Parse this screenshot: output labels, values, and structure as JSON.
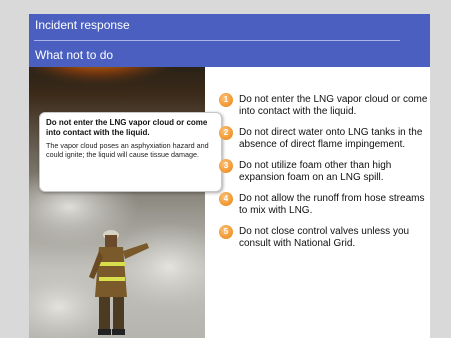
{
  "header": {
    "title": "Incident response",
    "subtitle": "What not to do"
  },
  "callout": {
    "heading": "Do not enter the LNG vapor cloud or come into contact with the liquid.",
    "body": "The vapor cloud poses an asphyxiation hazard and could ignite; the liquid will cause tissue damage."
  },
  "items": [
    {
      "number": "1",
      "text": "Do not enter the LNG vapor cloud or come into contact with the liquid."
    },
    {
      "number": "2",
      "text": "Do not direct water onto LNG tanks in the absence of direct flame impingement."
    },
    {
      "number": "3",
      "text": "Do not utilize foam other than high expansion foam on an LNG spill."
    },
    {
      "number": "4",
      "text": "Do not allow the runoff from hose streams to mix with LNG."
    },
    {
      "number": "5",
      "text": "Do not close control valves unless you consult with National Grid."
    }
  ],
  "colors": {
    "header_bg": "#4a5fc0",
    "bullet": "#f29a35",
    "page_bg": "#d9d9d9"
  }
}
